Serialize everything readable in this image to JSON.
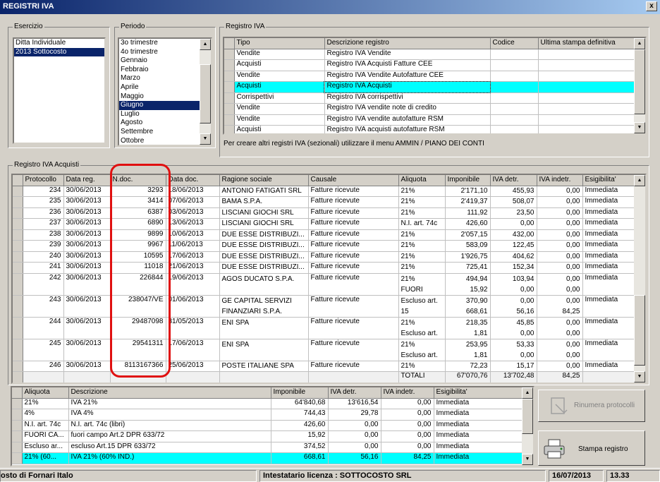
{
  "window": {
    "title": "REGISTRI IVA",
    "close_label": "x"
  },
  "esercizio": {
    "legend": "Esercizio",
    "items": [
      {
        "label": "Ditta Individuale",
        "selected": false
      },
      {
        "label": "2013 Sottocosto",
        "selected": true
      }
    ]
  },
  "periodo": {
    "legend": "Periodo",
    "items": [
      {
        "label": "3o trimestre",
        "selected": false
      },
      {
        "label": "4o trimestre",
        "selected": false
      },
      {
        "label": "Gennaio",
        "selected": false
      },
      {
        "label": "Febbraio",
        "selected": false
      },
      {
        "label": "Marzo",
        "selected": false
      },
      {
        "label": "Aprile",
        "selected": false
      },
      {
        "label": "Maggio",
        "selected": false
      },
      {
        "label": "Giugno",
        "selected": true
      },
      {
        "label": "Luglio",
        "selected": false
      },
      {
        "label": "Agosto",
        "selected": false
      },
      {
        "label": "Settembre",
        "selected": false
      },
      {
        "label": "Ottobre",
        "selected": false
      }
    ]
  },
  "registro": {
    "legend": "Registro IVA",
    "columns": [
      "Tipo",
      "Descrizione registro",
      "Codice",
      "Ultima stampa definitiva"
    ],
    "rows": [
      {
        "tipo": "Vendite",
        "descr": "Registro IVA Vendite",
        "codice": "",
        "ultima": "",
        "selected": false
      },
      {
        "tipo": "Acquisti",
        "descr": "Registro IVA Acquisti Fatture CEE",
        "codice": "",
        "ultima": "",
        "selected": false
      },
      {
        "tipo": "Vendite",
        "descr": "Registro IVA Vendite Autofatture CEE",
        "codice": "",
        "ultima": "",
        "selected": false
      },
      {
        "tipo": "Acquisti",
        "descr": "Registro IVA Acquisti",
        "codice": "",
        "ultima": "",
        "selected": true
      },
      {
        "tipo": "Corrispettivi",
        "descr": "Registro IVA corrispettivi",
        "codice": "",
        "ultima": "",
        "selected": false
      },
      {
        "tipo": "Vendite",
        "descr": "Registro IVA vendite note di credito",
        "codice": "",
        "ultima": "",
        "selected": false
      },
      {
        "tipo": "Vendite",
        "descr": "Registro IVA vendite autofatture RSM",
        "codice": "",
        "ultima": "",
        "selected": false
      },
      {
        "tipo": "Acquisti",
        "descr": "Registro IVA acquisti autofatture RSM",
        "codice": "",
        "ultima": "",
        "selected": false
      }
    ],
    "hint": "Per creare altri registri IVA (sezionali) utilizzare il menu AMMIN / PIANO DEI CONTI"
  },
  "acquisti": {
    "legend": "Registro IVA Acquisti",
    "columns": [
      "Protocollo",
      "Data reg.",
      "N.doc.",
      "Data doc.",
      "Ragione sociale",
      "Causale",
      "Aliquota",
      "Imponibile",
      "IVA detr.",
      "IVA indetr.",
      "Esigibilita'"
    ],
    "rows": [
      {
        "prot": "234",
        "datareg": "30/06/2013",
        "ndoc": "3293",
        "datadoc": "18/06/2013",
        "ragione": [
          "ANTONIO FATIGATI SRL"
        ],
        "causale": "Fatture ricevute",
        "aliquota": [
          "21%"
        ],
        "imponibile": [
          "2'171,10"
        ],
        "detr": [
          "455,93"
        ],
        "indetr": [
          "0,00"
        ],
        "esig": "Immediata"
      },
      {
        "prot": "235",
        "datareg": "30/06/2013",
        "ndoc": "3414",
        "datadoc": "07/06/2013",
        "ragione": [
          "BAMA S.P.A."
        ],
        "causale": "Fatture ricevute",
        "aliquota": [
          "21%"
        ],
        "imponibile": [
          "2'419,37"
        ],
        "detr": [
          "508,07"
        ],
        "indetr": [
          "0,00"
        ],
        "esig": "Immediata"
      },
      {
        "prot": "236",
        "datareg": "30/06/2013",
        "ndoc": "6387",
        "datadoc": "03/06/2013",
        "ragione": [
          "LISCIANI GIOCHI SRL"
        ],
        "causale": "Fatture ricevute",
        "aliquota": [
          "21%"
        ],
        "imponibile": [
          "111,92"
        ],
        "detr": [
          "23,50"
        ],
        "indetr": [
          "0,00"
        ],
        "esig": "Immediata"
      },
      {
        "prot": "237",
        "datareg": "30/06/2013",
        "ndoc": "6890",
        "datadoc": "13/06/2013",
        "ragione": [
          "LISCIANI GIOCHI SRL"
        ],
        "causale": "Fatture ricevute",
        "aliquota": [
          "N.I. art. 74c"
        ],
        "imponibile": [
          "426,60"
        ],
        "detr": [
          "0,00"
        ],
        "indetr": [
          "0,00"
        ],
        "esig": "Immediata"
      },
      {
        "prot": "238",
        "datareg": "30/06/2013",
        "ndoc": "9899",
        "datadoc": "10/06/2013",
        "ragione": [
          "DUE ESSE DISTRIBUZI..."
        ],
        "causale": "Fatture ricevute",
        "aliquota": [
          "21%"
        ],
        "imponibile": [
          "2'057,15"
        ],
        "detr": [
          "432,00"
        ],
        "indetr": [
          "0,00"
        ],
        "esig": "Immediata"
      },
      {
        "prot": "239",
        "datareg": "30/06/2013",
        "ndoc": "9967",
        "datadoc": "11/06/2013",
        "ragione": [
          "DUE ESSE DISTRIBUZI..."
        ],
        "causale": "Fatture ricevute",
        "aliquota": [
          "21%"
        ],
        "imponibile": [
          "583,09"
        ],
        "detr": [
          "122,45"
        ],
        "indetr": [
          "0,00"
        ],
        "esig": "Immediata"
      },
      {
        "prot": "240",
        "datareg": "30/06/2013",
        "ndoc": "10595",
        "datadoc": "17/06/2013",
        "ragione": [
          "DUE ESSE DISTRIBUZI..."
        ],
        "causale": "Fatture ricevute",
        "aliquota": [
          "21%"
        ],
        "imponibile": [
          "1'926,75"
        ],
        "detr": [
          "404,62"
        ],
        "indetr": [
          "0,00"
        ],
        "esig": "Immediata"
      },
      {
        "prot": "241",
        "datareg": "30/06/2013",
        "ndoc": "11018",
        "datadoc": "21/06/2013",
        "ragione": [
          "DUE ESSE DISTRIBUZI..."
        ],
        "causale": "Fatture ricevute",
        "aliquota": [
          "21%"
        ],
        "imponibile": [
          "725,41"
        ],
        "detr": [
          "152,34"
        ],
        "indetr": [
          "0,00"
        ],
        "esig": "Immediata"
      },
      {
        "prot": "242",
        "datareg": "30/06/2013",
        "ndoc": "226844",
        "datadoc": "19/06/2013",
        "ragione": [
          "AGOS DUCATO S.P.A."
        ],
        "causale": "Fatture ricevute",
        "aliquota": [
          "21%",
          "FUORI"
        ],
        "imponibile": [
          "494,94",
          "15,92"
        ],
        "detr": [
          "103,94",
          "0,00"
        ],
        "indetr": [
          "0,00",
          "0,00"
        ],
        "esig": "Immediata"
      },
      {
        "prot": "243",
        "datareg": "30/06/2013",
        "ndoc": "238047/VE",
        "datadoc": "01/06/2013",
        "ragione": [
          "GE CAPITAL SERVIZI",
          "FINANZIARI S.P.A."
        ],
        "causale": "Fatture ricevute",
        "aliquota": [
          "Escluso art.",
          "15"
        ],
        "imponibile": [
          "370,90",
          "668,61"
        ],
        "detr": [
          "0,00",
          "56,16"
        ],
        "indetr": [
          "0,00",
          "84,25"
        ],
        "esig": "Immediata"
      },
      {
        "prot": "244",
        "datareg": "30/06/2013",
        "ndoc": "29487098",
        "datadoc": "31/05/2013",
        "ragione": [
          "ENI SPA"
        ],
        "causale": "Fatture ricevute",
        "aliquota": [
          "21%",
          "Escluso art."
        ],
        "imponibile": [
          "218,35",
          "1,81"
        ],
        "detr": [
          "45,85",
          "0,00"
        ],
        "indetr": [
          "0,00",
          "0,00"
        ],
        "esig": "Immediata"
      },
      {
        "prot": "245",
        "datareg": "30/06/2013",
        "ndoc": "29541311",
        "datadoc": "17/06/2013",
        "ragione": [
          "ENI SPA"
        ],
        "causale": "Fatture ricevute",
        "aliquota": [
          "21%",
          "Escluso art."
        ],
        "imponibile": [
          "253,95",
          "1,81"
        ],
        "detr": [
          "53,33",
          "0,00"
        ],
        "indetr": [
          "0,00",
          "0,00"
        ],
        "esig": "Immediata"
      },
      {
        "prot": "246",
        "datareg": "30/06/2013",
        "ndoc": "8113167366",
        "datadoc": "25/06/2013",
        "ragione": [
          "POSTE ITALIANE SPA"
        ],
        "causale": "Fatture ricevute",
        "aliquota": [
          "21%"
        ],
        "imponibile": [
          "72,23"
        ],
        "detr": [
          "15,17"
        ],
        "indetr": [
          "0,00"
        ],
        "esig": "Immediata"
      }
    ],
    "totals": {
      "label": "TOTALI",
      "imponibile": "67'070,76",
      "detr": "13'702,48",
      "indetr": "84,25"
    }
  },
  "riepilogo": {
    "columns": [
      "Aliquota",
      "Descrizione",
      "Imponibile",
      "IVA detr.",
      "IVA indetr.",
      "Esigibilita'"
    ],
    "rows": [
      {
        "aliquota": "21%",
        "descr": "IVA 21%",
        "imponibile": "64'840,68",
        "detr": "13'616,54",
        "indetr": "0,00",
        "esig": "Immediata",
        "selected": false
      },
      {
        "aliquota": "4%",
        "descr": "IVA 4%",
        "imponibile": "744,43",
        "detr": "29,78",
        "indetr": "0,00",
        "esig": "Immediata",
        "selected": false
      },
      {
        "aliquota": "N.I. art. 74c",
        "descr": "N.I. art. 74c (libri)",
        "imponibile": "426,60",
        "detr": "0,00",
        "indetr": "0,00",
        "esig": "Immediata",
        "selected": false
      },
      {
        "aliquota": "FUORI CA...",
        "descr": "fuori campo Art.2 DPR 633/72",
        "imponibile": "15,92",
        "detr": "0,00",
        "indetr": "0,00",
        "esig": "Immediata",
        "selected": false
      },
      {
        "aliquota": "Escluso ar...",
        "descr": "escluso Art.15 DPR 633/72",
        "imponibile": "374,52",
        "detr": "0,00",
        "indetr": "0,00",
        "esig": "Immediata",
        "selected": false
      },
      {
        "aliquota": "21% (60...",
        "descr": "IVA 21% (60% IND.)",
        "imponibile": "668,61",
        "detr": "56,16",
        "indetr": "84,25",
        "esig": "Immediata",
        "selected": true
      }
    ]
  },
  "buttons": {
    "rinumera": "Rinumera protocolli",
    "stampa": "Stampa registro"
  },
  "status": {
    "company": "osto di Fornari Italo",
    "license": "Intestatario licenza : SOTTOCOSTO SRL",
    "date": "16/07/2013",
    "time": "13.33"
  }
}
